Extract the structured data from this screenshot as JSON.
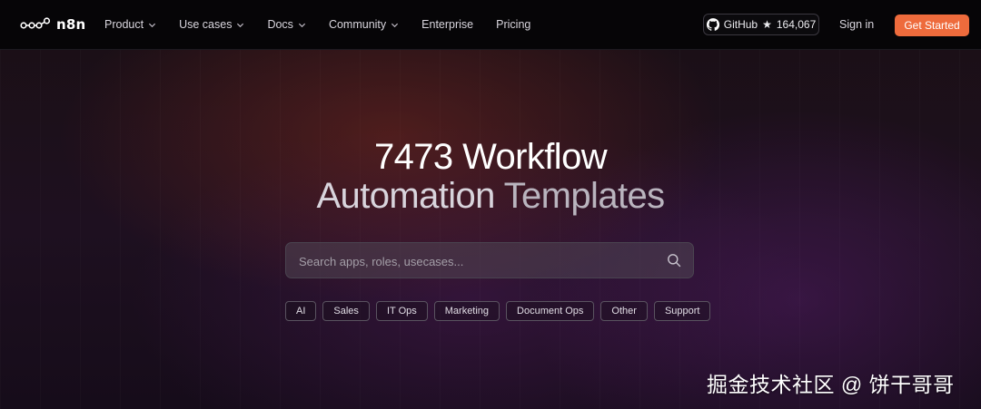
{
  "nav": {
    "logo_text": "n8n",
    "items": [
      {
        "label": "Product",
        "dropdown": true
      },
      {
        "label": "Use cases",
        "dropdown": true
      },
      {
        "label": "Docs",
        "dropdown": true
      },
      {
        "label": "Community",
        "dropdown": true
      },
      {
        "label": "Enterprise",
        "dropdown": false
      },
      {
        "label": "Pricing",
        "dropdown": false
      }
    ],
    "github_label": "GitHub",
    "github_stars": "164,067",
    "signin_label": "Sign in",
    "cta_label": "Get Started"
  },
  "hero": {
    "line1_a": "7473 Workflow",
    "line2_a": "Automation",
    "line2_b": "Templates"
  },
  "search": {
    "placeholder": "Search apps, roles, usecases..."
  },
  "categories": [
    "AI",
    "Sales",
    "IT Ops",
    "Marketing",
    "Document Ops",
    "Other",
    "Support"
  ],
  "watermark": "掘金技术社区 @ 饼干哥哥",
  "colors": {
    "accent": "#ee6b3c",
    "nav_bg": "#060507"
  }
}
